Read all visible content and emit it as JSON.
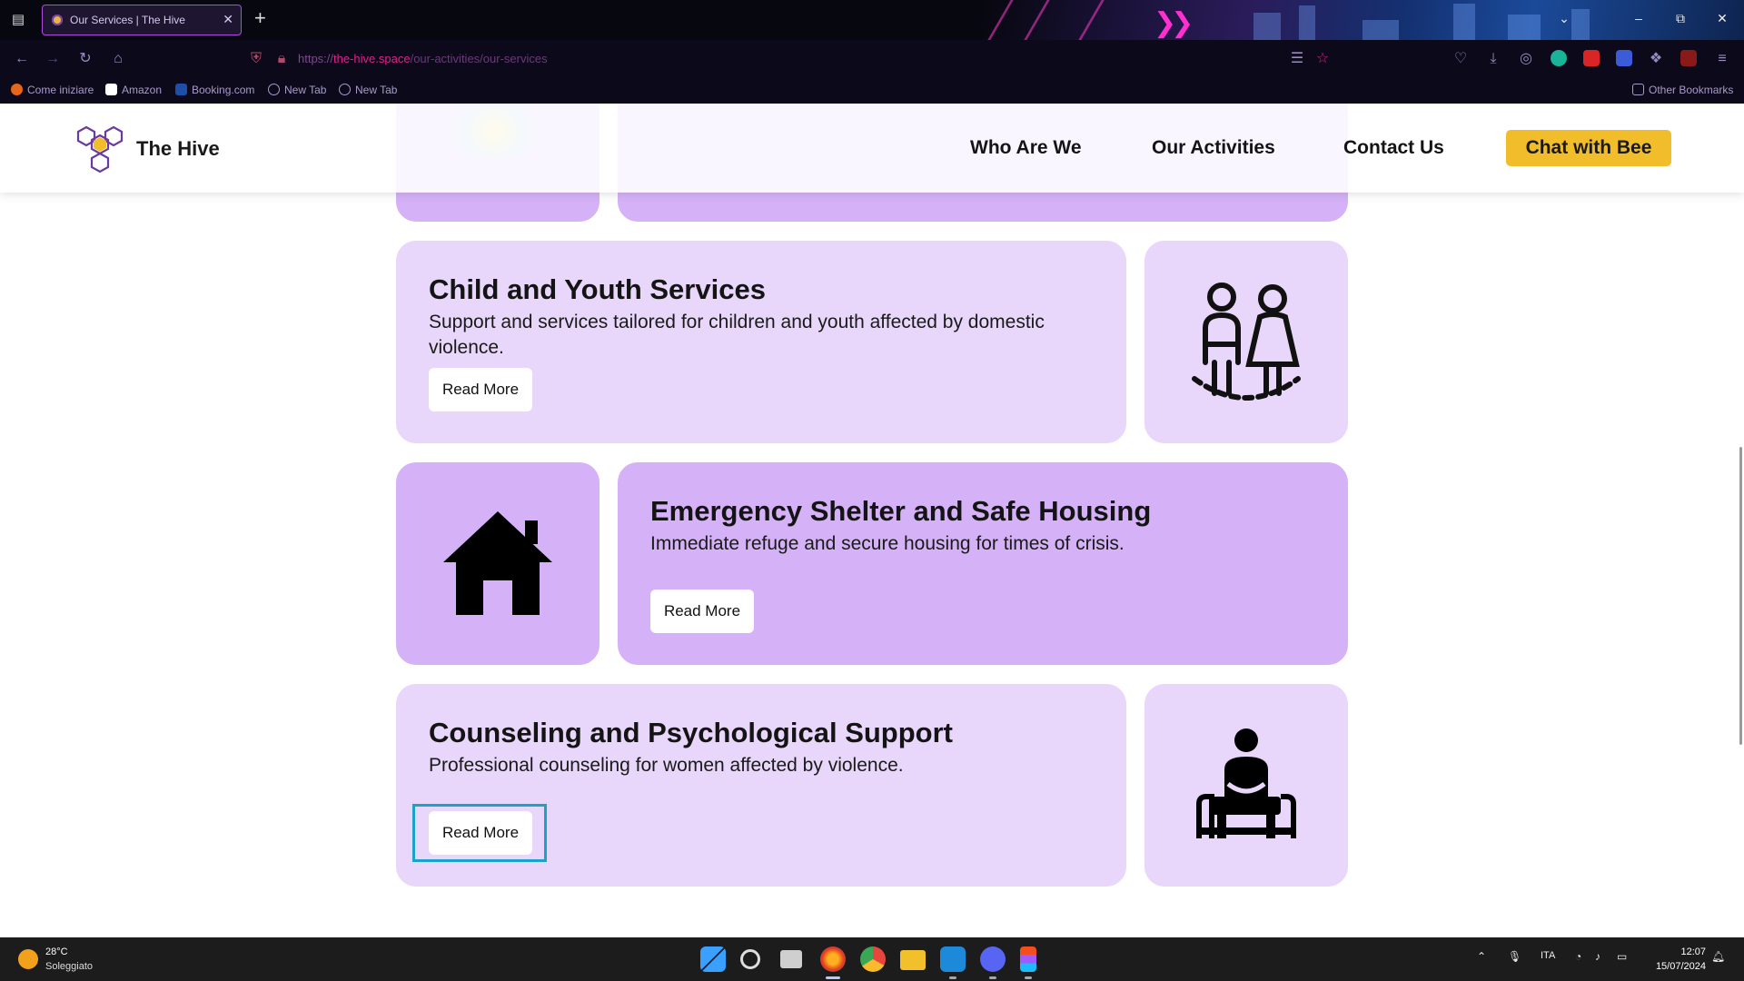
{
  "browser": {
    "tab_title": "Our Services | The Hive",
    "url_scheme": "https://",
    "url_host": "the-hive.space",
    "url_path": "/our-activities/our-services",
    "bookmarks": [
      "Come iniziare",
      "Amazon",
      "Booking.com",
      "New Tab",
      "New Tab"
    ],
    "other_bookmarks": "Other Bookmarks",
    "icons": [
      "tab-list-icon",
      "close-icon",
      "plus-icon",
      "back-icon",
      "forward-icon",
      "reload-icon",
      "home-icon",
      "shield-icon",
      "lock-icon",
      "reader-icon",
      "star-icon",
      "pocket-icon",
      "download-icon",
      "account-icon",
      "extensions-icon",
      "menu-icon"
    ]
  },
  "site": {
    "brand": "The Hive",
    "nav": [
      "Who Are We",
      "Our Activities",
      "Contact Us"
    ],
    "cta": "Chat with Bee"
  },
  "services": [
    {
      "title": "Child and Youth Services",
      "description": "Support and services tailored for children and youth affected by domestic violence.",
      "button": "Read More",
      "icon": "children-icon"
    },
    {
      "title": "Emergency Shelter and Safe Housing",
      "description": "Immediate refuge and secure housing for times of crisis.",
      "button": "Read More",
      "icon": "house-icon"
    },
    {
      "title": "Counseling and Psychological Support",
      "description": "Professional counseling for women affected by violence.",
      "button": "Read More",
      "icon": "counseling-person-icon"
    }
  ],
  "taskbar": {
    "temperature": "28°C",
    "weather": "Soleggiato",
    "language": "ITA",
    "time": "12:07",
    "date": "15/07/2024"
  },
  "colors": {
    "card_light": "#e8d6fb",
    "card_mid": "#d5b2f8",
    "cta": "#f2bd2a",
    "focus_ring": "#1aa3c8",
    "url_host": "#e0208a"
  }
}
